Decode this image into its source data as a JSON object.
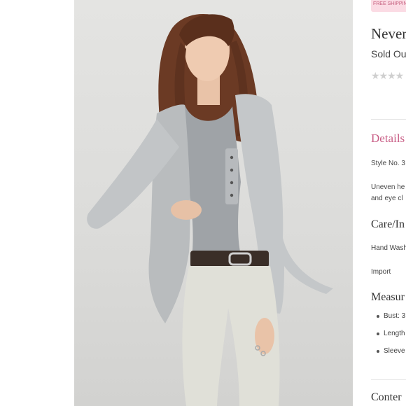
{
  "product": {
    "promo_text": "FREE SHIPPING",
    "title": "Never",
    "status": "Sold Ou",
    "rating_stars": "★★★★",
    "photo_alt": "Model wearing grey open-front cardigan with henley top and white jeans"
  },
  "details": {
    "heading": "Details",
    "style_no": "Style No. 3",
    "description_line1": "Uneven he",
    "description_line2": "and eye cl"
  },
  "care": {
    "heading": "Care/In",
    "wash": "Hand Wash",
    "origin": "Import"
  },
  "measurements": {
    "heading": "Measur",
    "items": [
      "Bust: 3",
      "Length",
      "Sleeve"
    ]
  },
  "contents": {
    "heading": "Conter"
  },
  "colors": {
    "accent_pink": "#c95e86",
    "promo_bg": "#fbdbe4",
    "star_grey": "#cfcfcf",
    "photo_bg": "#e0e0de"
  }
}
